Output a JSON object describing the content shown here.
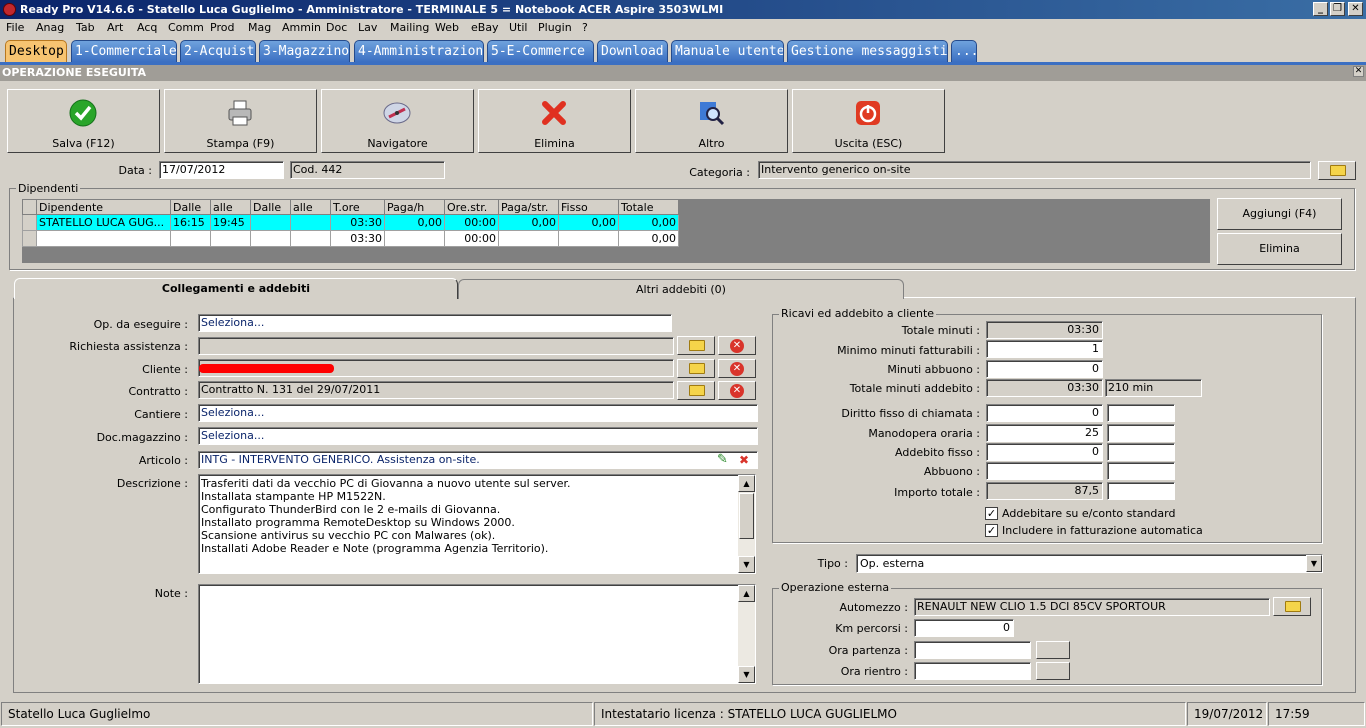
{
  "window": {
    "title": "Ready Pro V14.6.6 - Statello Luca Guglielmo - Amministratore - TERMINALE 5 = Notebook ACER Aspire 3503WLMI"
  },
  "menu": [
    "File",
    "Anag",
    "Tab",
    "Art",
    "Acq",
    "Comm",
    "Prod",
    "Mag",
    "Ammin",
    "Doc",
    "Lav",
    "Mailing",
    "Web",
    "eBay",
    "Util",
    "Plugin",
    "?"
  ],
  "tabs": [
    "Desktop",
    "1-Commerciale",
    "2-Acquisti",
    "3-Magazzino",
    "4-Amministrazione",
    "5-E-Commerce",
    "Download",
    "Manuale utente",
    "Gestione messaggistica",
    "..."
  ],
  "header": {
    "title": "OPERAZIONE ESEGUITA"
  },
  "toolbar": {
    "save": "Salva (F12)",
    "print": "Stampa (F9)",
    "navigator": "Navigatore",
    "delete": "Elimina",
    "other": "Altro",
    "exit": "Uscita (ESC)"
  },
  "form": {
    "data_label": "Data :",
    "data_value": "17/07/2012",
    "cod_value": "Cod. 442",
    "categoria_label": "Categoria :",
    "categoria_value": "Intervento generico on-site"
  },
  "employees": {
    "group_title": "Dipendenti",
    "columns": [
      "Dipendente",
      "Dalle",
      "alle",
      "Dalle",
      "alle",
      "T.ore",
      "Paga/h",
      "Ore.str.",
      "Paga/str.",
      "Fisso",
      "Totale"
    ],
    "rows": [
      [
        "STATELLO LUCA GUG...",
        "16:15",
        "19:45",
        "",
        "",
        "03:30",
        "0,00",
        "00:00",
        "0,00",
        "0,00",
        "0,00"
      ],
      [
        "",
        "",
        "",
        "",
        "",
        "03:30",
        "",
        "00:00",
        "",
        "",
        "0,00"
      ]
    ],
    "add_button": "Aggiungi (F4)",
    "delete_button": "Elimina"
  },
  "subtabs": {
    "links": "Collegamenti e addebiti",
    "other_charges": "Altri addebiti (0)"
  },
  "links": {
    "op_label": "Op. da eseguire :",
    "op_value": "Seleziona...",
    "richiesta_label": "Richiesta assistenza :",
    "richiesta_value": "",
    "cliente_label": "Cliente :",
    "contratto_label": "Contratto :",
    "contratto_value": "Contratto N. 131 del 29/07/2011",
    "cantiere_label": "Cantiere :",
    "cantiere_value": "Seleziona...",
    "docmag_label": "Doc.magazzino :",
    "docmag_value": "Seleziona...",
    "articolo_label": "Articolo :",
    "articolo_value": "INTG - INTERVENTO GENERICO. Assistenza on-site.",
    "descrizione_label": "Descrizione :",
    "descrizione_lines": [
      "Trasferiti dati da vecchio PC di Giovanna a nuovo utente sul server.",
      "Installata stampante HP M1522N.",
      "Configurato ThunderBird con le 2 e-mails di Giovanna.",
      "Installato programma RemoteDesktop su Windows 2000.",
      "Scansione antivirus su vecchio PC con Malwares (ok).",
      "Installati Adobe Reader e Note (programma Agenzia Territorio)."
    ],
    "note_label": "Note :"
  },
  "revenue": {
    "group_title": "Ricavi ed addebito a cliente",
    "totale_minuti_label": "Totale minuti :",
    "totale_minuti": "03:30",
    "minimo_label": "Minimo minuti fatturabili :",
    "minimo": "1",
    "abbuono_min_label": "Minuti abbuono :",
    "abbuono_min": "0",
    "tot_addebito_label": "Totale minuti addebito :",
    "tot_addebito": "03:30",
    "tot_addebito_min": "210 min",
    "diritto_label": "Diritto fisso di chiamata :",
    "diritto": "0",
    "manodopera_label": "Manodopera oraria :",
    "manodopera": "25",
    "addebito_label": "Addebito fisso :",
    "addebito": "0",
    "abbuono_label": "Abbuono :",
    "abbuono": "",
    "importo_label": "Importo totale :",
    "importo": "87,5",
    "chk1": "Addebitare su e/conto standard",
    "chk2": "Includere in fatturazione automatica"
  },
  "tipo": {
    "label": "Tipo :",
    "value": "Op. esterna"
  },
  "external": {
    "group_title": "Operazione esterna",
    "automezzo_label": "Automezzo :",
    "automezzo": "RENAULT NEW CLIO 1.5 DCI 85CV SPORTOUR",
    "km_label": "Km percorsi :",
    "km": "0",
    "partenza_label": "Ora partenza :",
    "rientro_label": "Ora rientro :"
  },
  "status": {
    "user": "Statello Luca Guglielmo",
    "license": "Intestatario licenza : STATELLO LUCA GUGLIELMO",
    "date": "19/07/2012",
    "time": "17:59"
  },
  "colors": {
    "accent": "#3b6fc2",
    "selected_row": "#00ffff",
    "active_tab": "#f7c471"
  }
}
